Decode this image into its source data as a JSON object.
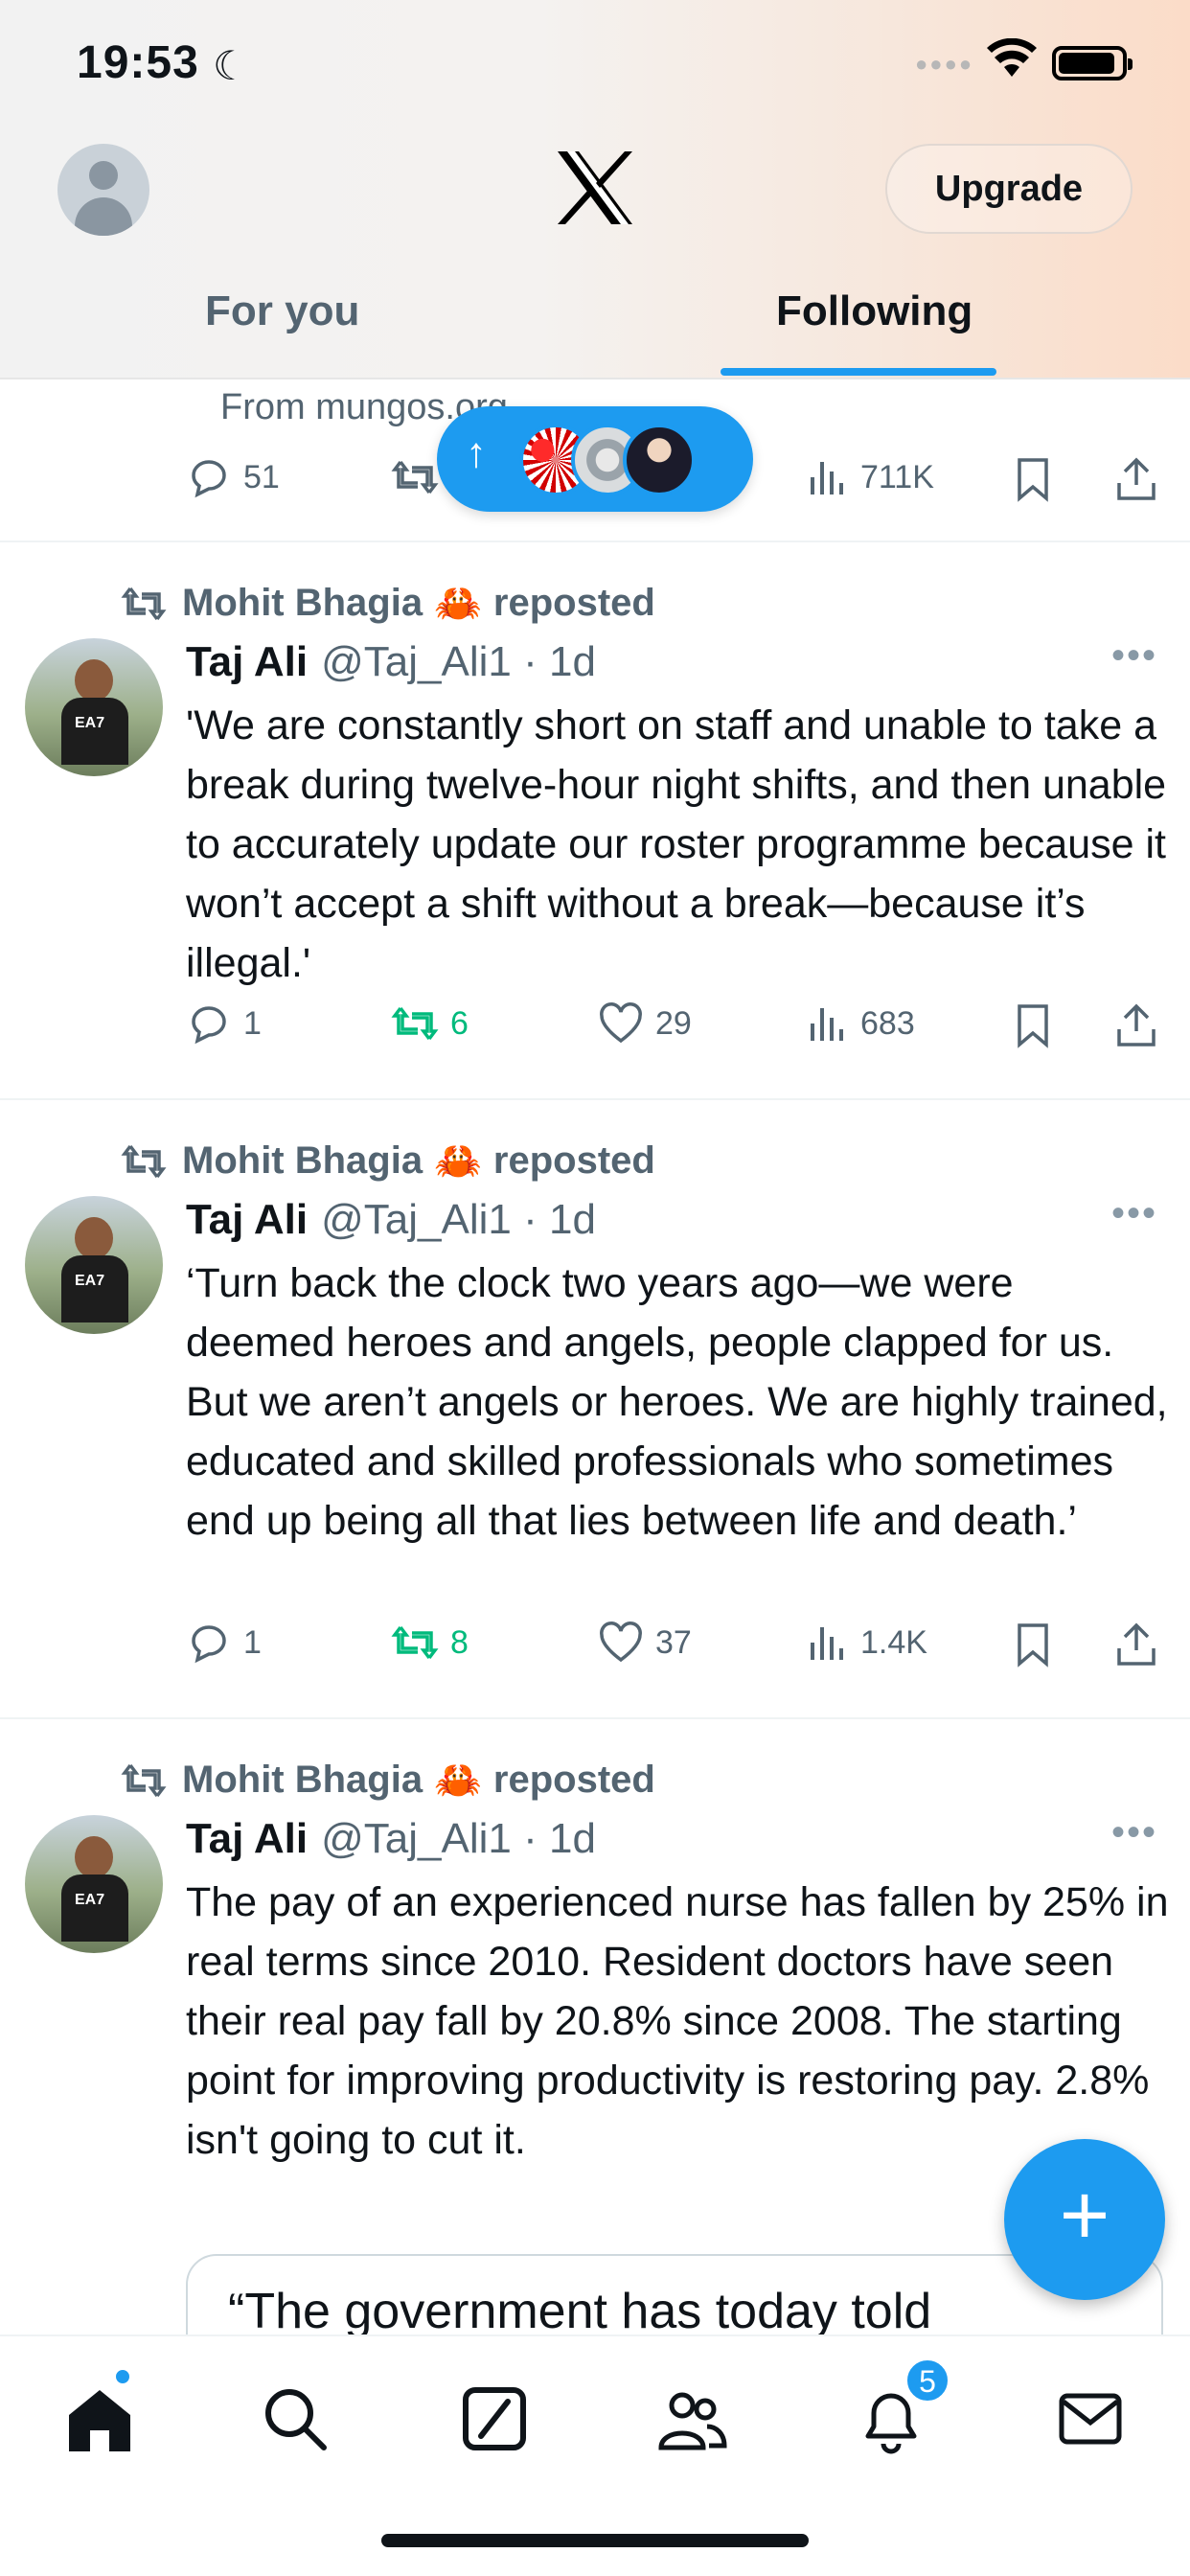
{
  "status_bar": {
    "time": "19:53"
  },
  "header": {
    "upgrade_label": "Upgrade",
    "tabs": [
      {
        "label": "For you"
      },
      {
        "label": "Following"
      }
    ],
    "active_tab": "Following"
  },
  "partial_post": {
    "from_line": "From mungos.org",
    "replies": "51",
    "views": "711K"
  },
  "posts": [
    {
      "reposted_by": "Mohit Bhagia",
      "reposted_suffix": "reposted",
      "author": "Taj Ali",
      "handle": "@Taj_Ali1 · 1d",
      "text": "'We are constantly short on staff and unable to take a break during twelve-hour night shifts, and then unable to accurately update our roster programme because it won’t accept a shift without a break—because it’s illegal.'",
      "replies": "1",
      "reposts": "6",
      "likes": "29",
      "views": "683"
    },
    {
      "reposted_by": "Mohit Bhagia",
      "reposted_suffix": "reposted",
      "author": "Taj Ali",
      "handle": "@Taj_Ali1 · 1d",
      "text": "‘Turn back the clock two years ago—we were deemed heroes and angels, people clapped for us. But we aren’t angels or heroes. We are highly trained, educated and skilled professionals who sometimes end up being all that lies between life and death.’",
      "replies": "1",
      "reposts": "8",
      "likes": "37",
      "views": "1.4K"
    },
    {
      "reposted_by": "Mohit Bhagia",
      "reposted_suffix": "reposted",
      "author": "Taj Ali",
      "handle": "@Taj_Ali1 · 1d",
      "text": "The pay of an experienced nurse has fallen by 25% in real terms since 2010. Resident doctors have seen their real pay fall by 20.8% since 2008. The starting point for improving productivity is restoring pay. 2.8% isn't going to cut it.",
      "quote_text": "“The government has today told"
    }
  ],
  "bottom_nav": {
    "notification_count": "5"
  },
  "colors": {
    "accent": "#1d9bf0",
    "repost_green": "#00ba7c",
    "secondary_text": "#536471"
  }
}
